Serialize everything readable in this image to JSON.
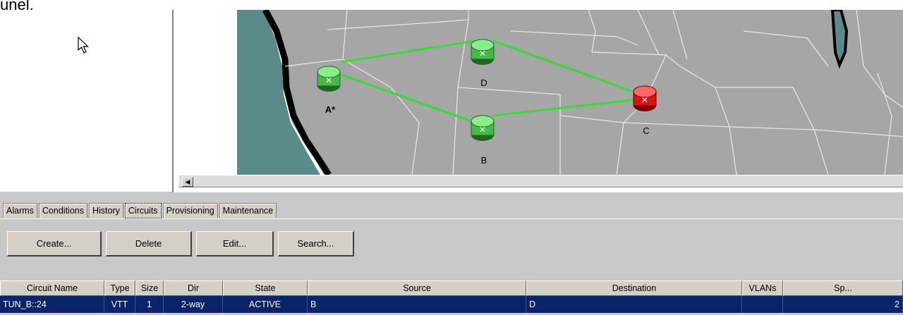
{
  "top_text": "unel.",
  "map": {
    "nodes": [
      {
        "id": "A",
        "label": "A*",
        "color": "green"
      },
      {
        "id": "D",
        "label": "D",
        "color": "green"
      },
      {
        "id": "B",
        "label": "B",
        "color": "green"
      },
      {
        "id": "C",
        "label": "C",
        "color": "red"
      }
    ],
    "links": [
      [
        "A",
        "D"
      ],
      [
        "A",
        "B"
      ],
      [
        "D",
        "C"
      ],
      [
        "B",
        "C"
      ]
    ],
    "link_color": "#33dd33"
  },
  "tabs": [
    {
      "label": "Alarms"
    },
    {
      "label": "Conditions"
    },
    {
      "label": "History"
    },
    {
      "label": "Circuits",
      "active": true
    },
    {
      "label": "Provisioning"
    },
    {
      "label": "Maintenance"
    }
  ],
  "buttons": {
    "create": "Create...",
    "delete": "Delete",
    "edit": "Edit...",
    "search": "Search..."
  },
  "table": {
    "headers": [
      "Circuit Name",
      "Type",
      "Size",
      "Dir",
      "State",
      "Source",
      "Destination",
      "VLANs",
      "Sp..."
    ],
    "rows": [
      [
        "TUN_B::24",
        "VTT",
        "1",
        "2-way",
        "ACTIVE",
        "B",
        "D",
        "",
        "2"
      ]
    ]
  },
  "colors": {
    "selection": "#0a246a",
    "map_bg": "#a6a6a6",
    "water": "#5a8a8a",
    "red_node": "#dd1111",
    "green_node": "#44bb44"
  }
}
